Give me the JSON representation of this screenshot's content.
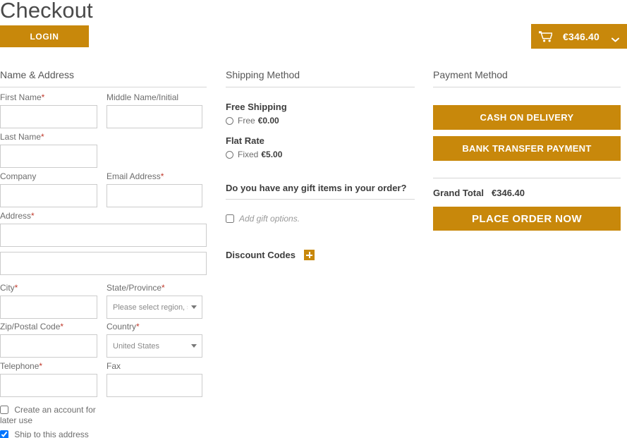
{
  "header": {
    "title": "Checkout",
    "login_label": "LOGIN",
    "cart": {
      "icon": "shopping-cart-icon",
      "total": "€346.40",
      "caret": "chevron-down-icon"
    }
  },
  "name_address": {
    "heading": "Name & Address",
    "fields": {
      "first_name": {
        "label": "First Name",
        "required": "*",
        "value": ""
      },
      "middle_name": {
        "label": "Middle Name/Initial",
        "required": "",
        "value": ""
      },
      "last_name": {
        "label": "Last Name",
        "required": "*",
        "value": ""
      },
      "company": {
        "label": "Company",
        "required": "",
        "value": ""
      },
      "email": {
        "label": "Email Address",
        "required": "*",
        "value": ""
      },
      "address": {
        "label": "Address",
        "required": "*",
        "value": "",
        "value2": ""
      },
      "city": {
        "label": "City",
        "required": "*",
        "value": ""
      },
      "state": {
        "label": "State/Province",
        "required": "*",
        "value": "Please select region, state"
      },
      "zip": {
        "label": "Zip/Postal Code",
        "required": "*",
        "value": ""
      },
      "country": {
        "label": "Country",
        "required": "*",
        "value": "United States"
      },
      "telephone": {
        "label": "Telephone",
        "required": "*",
        "value": ""
      },
      "fax": {
        "label": "Fax",
        "required": "",
        "value": ""
      }
    },
    "create_account_label": "Create an account for later use",
    "create_account_checked": false,
    "ship_here_label": "Ship to this address",
    "ship_here_checked": true
  },
  "shipping": {
    "heading": "Shipping Method",
    "methods": [
      {
        "title": "Free Shipping",
        "option_label": "Free",
        "price": "€0.00",
        "selected": false
      },
      {
        "title": "Flat Rate",
        "option_label": "Fixed",
        "price": "€5.00",
        "selected": false
      }
    ],
    "gift_question": "Do you have any gift items in your order?",
    "gift_option_label": "Add gift options.",
    "gift_option_checked": false,
    "discount_label": "Discount Codes",
    "discount_add_icon": "plus-icon"
  },
  "payment": {
    "heading": "Payment Method",
    "methods": [
      {
        "label": "CASH ON DELIVERY"
      },
      {
        "label": "BANK TRANSFER PAYMENT"
      }
    ],
    "grand_total_label": "Grand Total",
    "grand_total_value": "€346.40",
    "place_order_label": "PLACE ORDER NOW"
  },
  "colors": {
    "accent": "#c8880b",
    "required": "#c0392b",
    "border": "#cccccc",
    "rule": "#d6d6d6"
  }
}
